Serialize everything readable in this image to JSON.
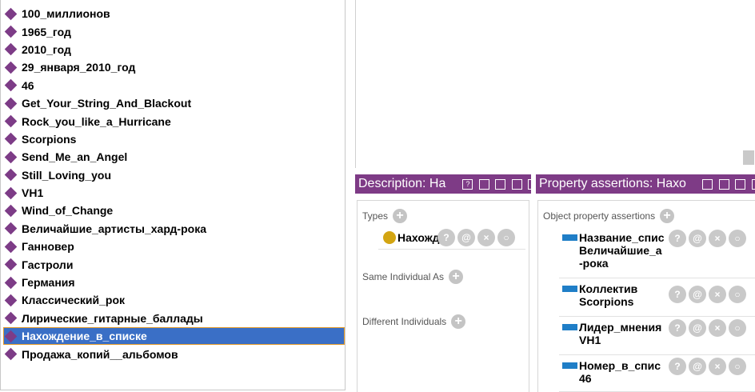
{
  "individuals": [
    {
      "label": "100_миллионов"
    },
    {
      "label": "1965_год"
    },
    {
      "label": "2010_год"
    },
    {
      "label": "29_января_2010_год"
    },
    {
      "label": "46"
    },
    {
      "label": "Get_Your_String_And_Blackout"
    },
    {
      "label": "Rock_you_like_a_Hurricane"
    },
    {
      "label": "Scorpions"
    },
    {
      "label": "Send_Me_an_Angel"
    },
    {
      "label": "Still_Loving_you"
    },
    {
      "label": "VH1"
    },
    {
      "label": "Wind_of_Change"
    },
    {
      "label": "Величайшие_артисты_хард-рока"
    },
    {
      "label": "Ганновер"
    },
    {
      "label": "Гастроли"
    },
    {
      "label": "Германия"
    },
    {
      "label": "Классический_рок"
    },
    {
      "label": "Лирические_гитарные_баллады"
    },
    {
      "label": "Нахождение_в_списке",
      "selected": true
    },
    {
      "label": "Продажа_копий__альбомов"
    }
  ],
  "description_panel": {
    "title": "Description: На",
    "types_label": "Types",
    "type_entry": "Нахожд",
    "same_individual_label": "Same Individual As",
    "different_individuals_label": "Different Individuals"
  },
  "property_panel": {
    "title": "Property assertions: Нахо",
    "object_assertions_label": "Object property assertions",
    "assertions": [
      {
        "line1": "Название_спис",
        "line2": "Величайшие_а",
        "line3": "-рока"
      },
      {
        "line1": "Коллектив",
        "line2": "Scorpions",
        "line3": ""
      },
      {
        "line1": "Лидер_мнения",
        "line2": "VH1",
        "line3": ""
      },
      {
        "line1": "Номер_в_спис",
        "line2": "46",
        "line3": ""
      }
    ]
  },
  "icons": {
    "individual": "diamond-icon",
    "class": "class-circle-icon",
    "object_property": "object-property-icon",
    "add": "add-icon",
    "explain": "help-icon",
    "annotate": "annotate-icon",
    "delete": "delete-icon",
    "edit": "edit-icon"
  },
  "colors": {
    "panel_header": "#7e3b86",
    "individual_icon": "#7d3c87",
    "selection": "#3a6fc6",
    "class_icon": "#d3a512",
    "property_icon": "#1f7ec7"
  }
}
